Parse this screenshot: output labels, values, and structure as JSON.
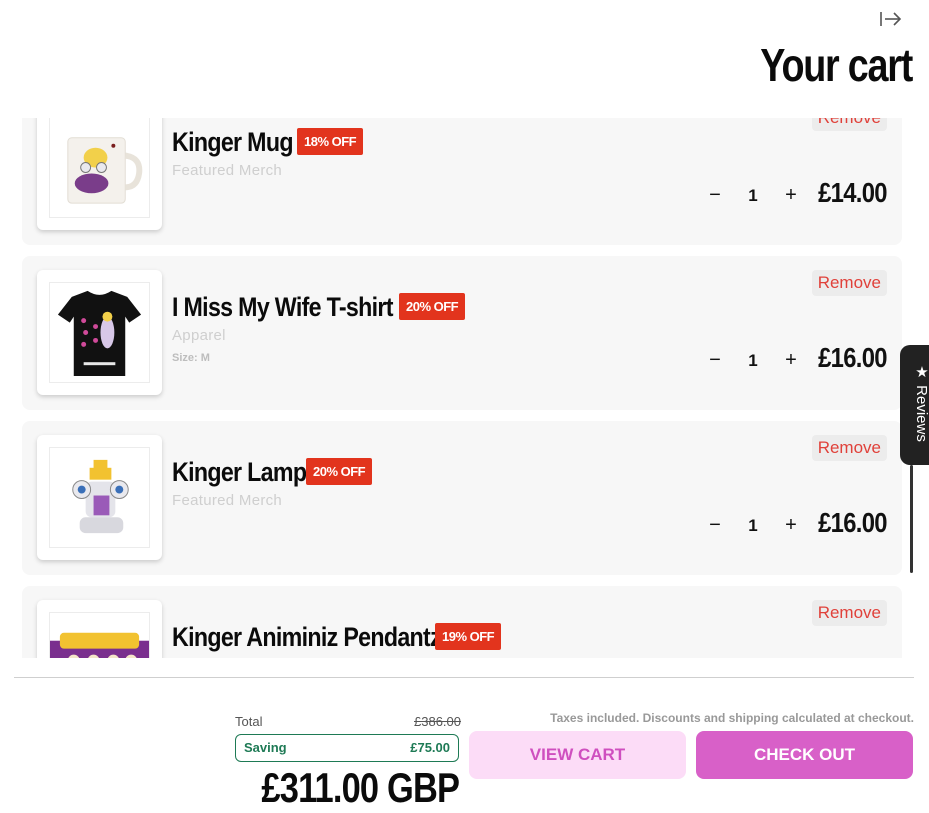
{
  "header": {
    "title": "Your cart",
    "close_icon": "exit-arrow-icon"
  },
  "items": [
    {
      "name": "Kinger Mug",
      "discount": "18% OFF",
      "category": "Featured Merch",
      "variant": "",
      "quantity": "1",
      "price": "£14.00",
      "remove_label": "Remove",
      "image_icon": "mug-image"
    },
    {
      "name": "I Miss My Wife T-shirt",
      "discount": "20% OFF",
      "category": "Apparel",
      "variant": "Size: M",
      "quantity": "1",
      "price": "£16.00",
      "remove_label": "Remove",
      "image_icon": "tshirt-image"
    },
    {
      "name": "Kinger Lamp",
      "discount": "20% OFF",
      "category": "Featured Merch",
      "variant": "",
      "quantity": "1",
      "price": "£16.00",
      "remove_label": "Remove",
      "image_icon": "lamp-image"
    },
    {
      "name": "Kinger Animiniz Pendantz",
      "discount": "19% OFF",
      "category": "",
      "variant": "",
      "quantity": "",
      "price": "",
      "remove_label": "Remove",
      "image_icon": "pendant-box-image"
    }
  ],
  "qty_controls": {
    "minus": "−",
    "plus": "+"
  },
  "reviews_tab": {
    "label": "Reviews",
    "icon": "star-icon"
  },
  "footer": {
    "total_label": "Total",
    "compare_total": "£386.00",
    "saving_label": "Saving",
    "saving_amount": "£75.00",
    "grand_total": "£311.00 GBP",
    "tax_note": "Taxes included. Discounts and shipping calculated at checkout.",
    "view_cart_label": "VIEW CART",
    "checkout_label": "CHECK OUT"
  },
  "colors": {
    "discount_badge": "#e2341d",
    "remove_text": "#e0413a",
    "saving_green": "#1e7a55",
    "checkout_bg": "#d860c8",
    "view_cart_bg": "#fcdcf7"
  }
}
